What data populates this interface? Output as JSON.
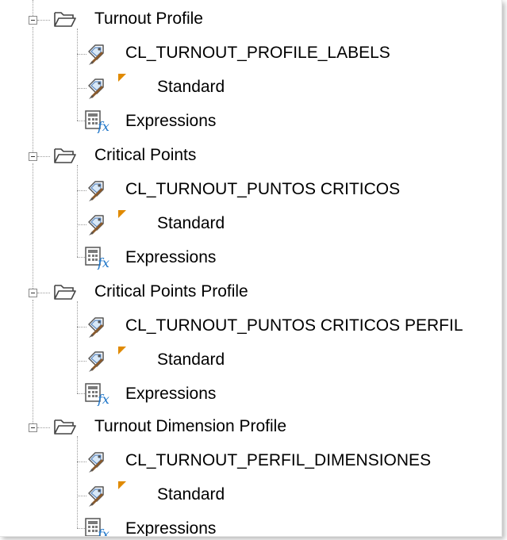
{
  "tree": {
    "groups": [
      {
        "label": "Turnout Profile",
        "children": [
          {
            "label": "CL_TURNOUT_PROFILE_LABELS",
            "icon": "label-style-icon"
          },
          {
            "label": "Standard",
            "icon": "label-style-icon"
          },
          {
            "label": "Expressions",
            "icon": "expressions-icon"
          }
        ]
      },
      {
        "label": "Critical Points",
        "children": [
          {
            "label": "CL_TURNOUT_PUNTOS CRITICOS",
            "icon": "label-style-icon"
          },
          {
            "label": "Standard",
            "icon": "label-style-icon"
          },
          {
            "label": "Expressions",
            "icon": "expressions-icon"
          }
        ]
      },
      {
        "label": "Critical Points Profile",
        "children": [
          {
            "label": "CL_TURNOUT_PUNTOS CRITICOS PERFIL",
            "icon": "label-style-icon"
          },
          {
            "label": "Standard",
            "icon": "label-style-icon"
          },
          {
            "label": "Expressions",
            "icon": "expressions-icon"
          }
        ]
      },
      {
        "label": "Turnout Dimension Profile",
        "children": [
          {
            "label": "CL_TURNOUT_PERFIL_DIMENSIONES",
            "icon": "label-style-icon"
          },
          {
            "label": "Standard",
            "icon": "label-style-icon"
          },
          {
            "label": "Expressions",
            "icon": "expressions-icon"
          }
        ]
      }
    ]
  },
  "colors": {
    "dotted_line": "#9a9a9a",
    "default_marker": "#e08a00",
    "fx_blue": "#1a73c8"
  }
}
